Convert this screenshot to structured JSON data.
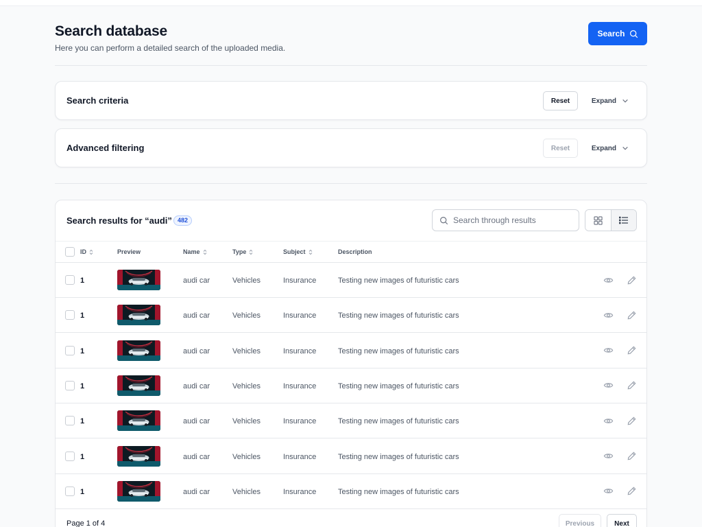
{
  "header": {
    "title": "Search database",
    "subtitle": "Here you can perform a detailed search of the uploaded media.",
    "search_label": "Search"
  },
  "panels": [
    {
      "title": "Search criteria",
      "reset_label": "Reset",
      "expand_label": "Expand",
      "reset_disabled": false
    },
    {
      "title": "Advanced filtering",
      "reset_label": "Reset",
      "expand_label": "Expand",
      "reset_disabled": true
    }
  ],
  "results": {
    "title": "Search results for “audi”",
    "count": "482",
    "search_placeholder": "Search through results",
    "columns": {
      "id": "ID",
      "preview": "Preview",
      "name": "Name",
      "type": "Type",
      "subject": "Subject",
      "description": "Description"
    },
    "rows": [
      {
        "id": "1",
        "name": "audi car",
        "type": "Vehicles",
        "subject": "Insurance",
        "description": "Testing new images of futuristic cars"
      },
      {
        "id": "1",
        "name": "audi car",
        "type": "Vehicles",
        "subject": "Insurance",
        "description": "Testing new images of futuristic cars"
      },
      {
        "id": "1",
        "name": "audi car",
        "type": "Vehicles",
        "subject": "Insurance",
        "description": "Testing new images of futuristic cars"
      },
      {
        "id": "1",
        "name": "audi car",
        "type": "Vehicles",
        "subject": "Insurance",
        "description": "Testing new images of futuristic cars"
      },
      {
        "id": "1",
        "name": "audi car",
        "type": "Vehicles",
        "subject": "Insurance",
        "description": "Testing new images of futuristic cars"
      },
      {
        "id": "1",
        "name": "audi car",
        "type": "Vehicles",
        "subject": "Insurance",
        "description": "Testing new images of futuristic cars"
      },
      {
        "id": "1",
        "name": "audi car",
        "type": "Vehicles",
        "subject": "Insurance",
        "description": "Testing new images of futuristic cars"
      }
    ],
    "row_actions": [
      "eye-icon",
      "pencil-icon"
    ],
    "view_modes": [
      "grid-view-icon",
      "list-view-icon"
    ],
    "active_view": "list"
  },
  "pagination": {
    "info": "Page 1 of 4",
    "previous_label": "Previous",
    "next_label": "Next",
    "previous_disabled": true
  },
  "colors": {
    "primary": "#1463f3",
    "background": "#f9fafb",
    "badge_bg": "#eff4ff",
    "badge_text": "#1d4ed8"
  }
}
